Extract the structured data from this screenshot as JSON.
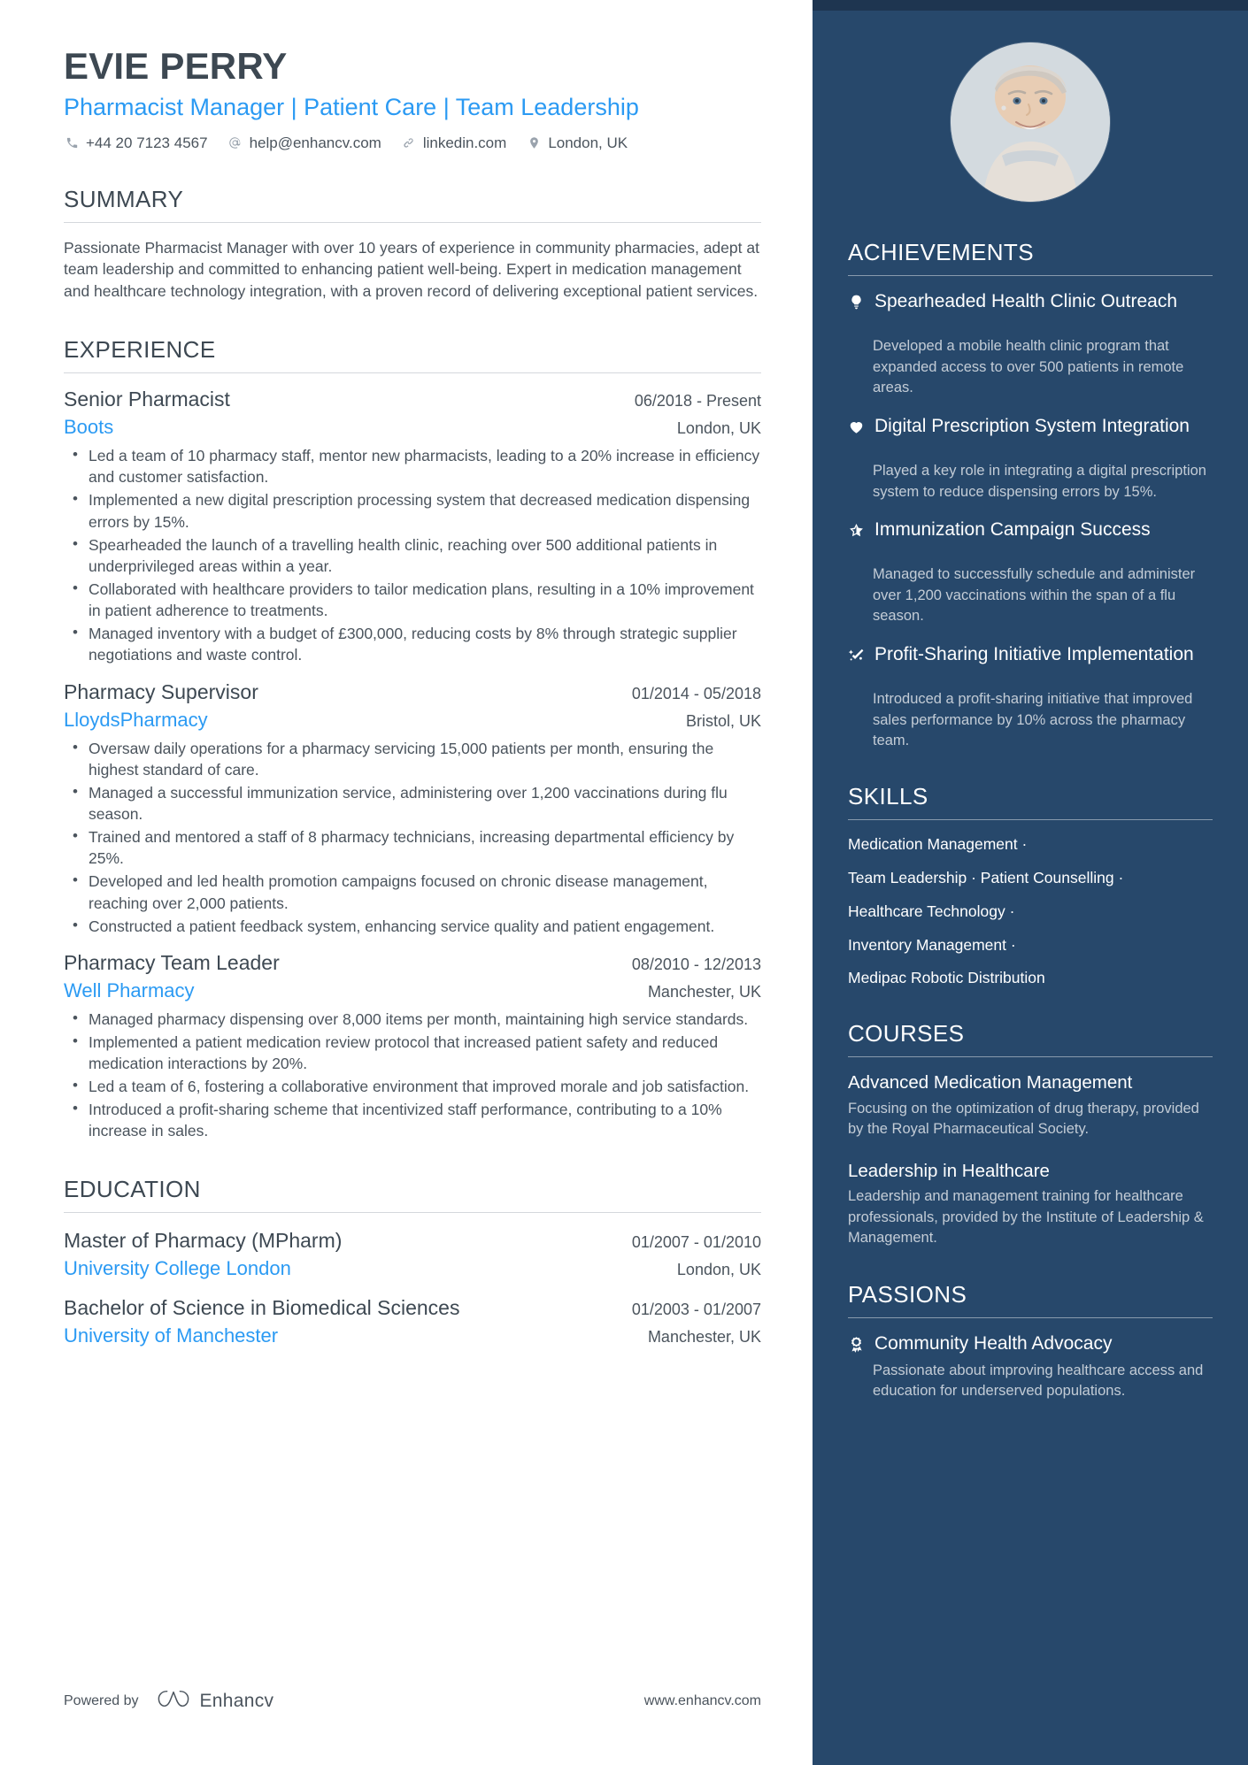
{
  "header": {
    "name": "EVIE PERRY",
    "headline": "Pharmacist Manager | Patient Care | Team Leadership",
    "contacts": [
      {
        "icon": "phone-icon",
        "text": "+44 20 7123 4567"
      },
      {
        "icon": "email-icon",
        "text": "help@enhancv.com"
      },
      {
        "icon": "link-icon",
        "text": "linkedin.com"
      },
      {
        "icon": "location-pin-icon",
        "text": "London, UK"
      }
    ]
  },
  "summary": {
    "heading": "SUMMARY",
    "text": "Passionate Pharmacist Manager with over 10 years of experience in community pharmacies, adept at team leadership and committed to enhancing patient well-being. Expert in medication management and healthcare technology integration, with a proven record of delivering exceptional patient services."
  },
  "experience": {
    "heading": "EXPERIENCE",
    "jobs": [
      {
        "title": "Senior Pharmacist",
        "dates": "06/2018 - Present",
        "company": "Boots",
        "location": "London, UK",
        "bullets": [
          "Led a team of 10 pharmacy staff, mentor new pharmacists, leading to a 20% increase in efficiency and customer satisfaction.",
          "Implemented a new digital prescription processing system that decreased medication dispensing errors by 15%.",
          "Spearheaded the launch of a travelling health clinic, reaching over 500 additional patients in underprivileged areas within a year.",
          "Collaborated with healthcare providers to tailor medication plans, resulting in a 10% improvement in patient adherence to treatments.",
          "Managed inventory with a budget of £300,000, reducing costs by 8% through strategic supplier negotiations and waste control."
        ]
      },
      {
        "title": "Pharmacy Supervisor",
        "dates": "01/2014 - 05/2018",
        "company": "LloydsPharmacy",
        "location": "Bristol, UK",
        "bullets": [
          "Oversaw daily operations for a pharmacy servicing 15,000 patients per month, ensuring the highest standard of care.",
          "Managed a successful immunization service, administering over 1,200 vaccinations during flu season.",
          "Trained and mentored a staff of 8 pharmacy technicians, increasing departmental efficiency by 25%.",
          "Developed and led health promotion campaigns focused on chronic disease management, reaching over 2,000 patients.",
          "Constructed a patient feedback system, enhancing service quality and patient engagement."
        ]
      },
      {
        "title": "Pharmacy Team Leader",
        "dates": "08/2010 - 12/2013",
        "company": "Well Pharmacy",
        "location": "Manchester, UK",
        "bullets": [
          "Managed pharmacy dispensing over 8,000 items per month, maintaining high service standards.",
          "Implemented a patient medication review protocol that increased patient safety and reduced medication interactions by 20%.",
          "Led a team of 6, fostering a collaborative environment that improved morale and job satisfaction.",
          "Introduced a profit-sharing scheme that incentivized staff performance, contributing to a 10% increase in sales."
        ]
      }
    ]
  },
  "education": {
    "heading": "EDUCATION",
    "items": [
      {
        "degree": "Master of Pharmacy (MPharm)",
        "dates": "01/2007 - 01/2010",
        "school": "University College London",
        "location": "London, UK"
      },
      {
        "degree": "Bachelor of Science in Biomedical Sciences",
        "dates": "01/2003 - 01/2007",
        "school": "University of Manchester",
        "location": "Manchester, UK"
      }
    ]
  },
  "achievements": {
    "heading": "ACHIEVEMENTS",
    "items": [
      {
        "icon": "lightbulb-icon",
        "title": "Spearheaded Health Clinic Outreach",
        "desc": "Developed a mobile health clinic program that expanded access to over 500 patients in remote areas."
      },
      {
        "icon": "heart-icon",
        "title": "Digital Prescription System Integration",
        "desc": "Played a key role in integrating a digital prescription system to reduce dispensing errors by 15%."
      },
      {
        "icon": "star-half-icon",
        "title": "Immunization Campaign Success",
        "desc": "Managed to successfully schedule and administer over 1,200 vaccinations within the span of a flu season."
      },
      {
        "icon": "growth-arrow-icon",
        "title": "Profit-Sharing Initiative Implementation",
        "desc": "Introduced a profit-sharing initiative that improved sales performance by 10% across the pharmacy team."
      }
    ]
  },
  "skills": {
    "heading": "SKILLS",
    "lines": [
      "Medication Management ·",
      "Team Leadership · Patient Counselling ·",
      "Healthcare Technology ·",
      "Inventory Management ·",
      "Medipac Robotic Distribution"
    ]
  },
  "courses": {
    "heading": "COURSES",
    "items": [
      {
        "title": "Advanced Medication Management",
        "desc": "Focusing on the optimization of drug therapy, provided by the Royal Pharmaceutical Society."
      },
      {
        "title": "Leadership in Healthcare",
        "desc": "Leadership and management training for healthcare professionals, provided by the Institute of Leadership & Management."
      }
    ]
  },
  "passions": {
    "heading": "PASSIONS",
    "items": [
      {
        "icon": "award-ribbon-icon",
        "title": "Community Health Advocacy",
        "desc": "Passionate about improving healthcare access and education for underserved populations."
      }
    ]
  },
  "footer": {
    "powered_by": "Powered by",
    "brand": "Enhancv",
    "site": "www.enhancv.com"
  },
  "colors": {
    "sidebar_bg": "#27486b",
    "sidebar_topbar": "#1e3550",
    "accent_blue": "#2b9af3",
    "heading_dark": "#3d4852",
    "body_text": "#4b545d",
    "sidebar_muted": "#c3ccd6"
  }
}
